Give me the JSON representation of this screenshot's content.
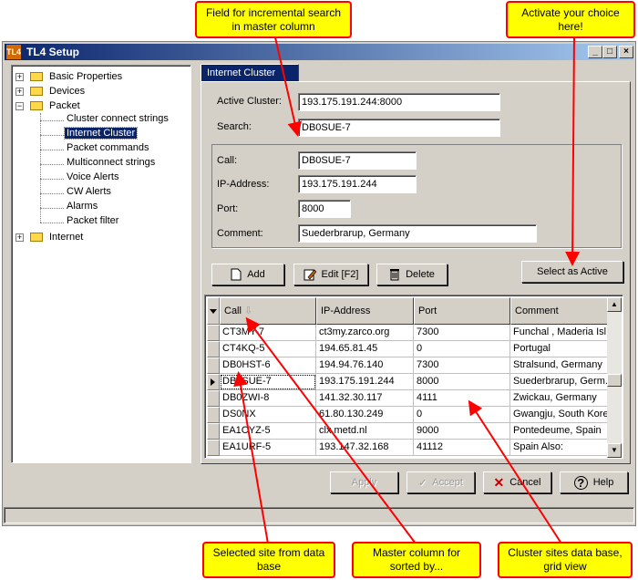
{
  "window": {
    "title": "TL4 Setup",
    "app_icon": "TL4"
  },
  "callouts": {
    "incremental_search": "Field for incremental search in master column",
    "activate": "Activate your choice here!",
    "selected_site": "Selected site from data base",
    "master_column": "Master column for sorted by...",
    "cluster_db": "Cluster sites data base, grid view"
  },
  "tree": {
    "items": [
      {
        "label": "Basic Properties"
      },
      {
        "label": "Devices"
      },
      {
        "label": "Packet"
      },
      {
        "label": "Cluster connect strings"
      },
      {
        "label": "Internet Cluster"
      },
      {
        "label": "Packet commands"
      },
      {
        "label": "Multiconnect strings"
      },
      {
        "label": "Voice Alerts"
      },
      {
        "label": "CW Alerts"
      },
      {
        "label": "Alarms"
      },
      {
        "label": "Packet filter"
      },
      {
        "label": "Internet"
      }
    ]
  },
  "tab": {
    "label": "Internet Cluster"
  },
  "form": {
    "active_cluster_label": "Active Cluster:",
    "active_cluster_value": "193.175.191.244:8000",
    "search_label": "Search:",
    "search_value": "DB0SUE-7",
    "call_label": "Call:",
    "call_value": "DB0SUE-7",
    "ip_label": "IP-Address:",
    "ip_value": "193.175.191.244",
    "port_label": "Port:",
    "port_value": "8000",
    "comment_label": "Comment:",
    "comment_value": "Suederbrarup, Germany"
  },
  "buttons": {
    "add": "Add",
    "edit": "Edit [F2]",
    "delete": "Delete",
    "select_active": "Select as Active",
    "apply": "Apply",
    "accept": "Accept",
    "cancel": "Cancel",
    "help": "Help"
  },
  "grid": {
    "columns": [
      "Call",
      "IP-Address",
      "Port",
      "Comment"
    ],
    "rows": [
      [
        "CT3MY-7",
        "ct3my.zarco.org",
        "7300",
        "Funchal , Maderia Isl..."
      ],
      [
        "CT4KQ-5",
        "194.65.81.45",
        "0",
        "Portugal"
      ],
      [
        "DB0HST-6",
        "194.94.76.140",
        "7300",
        "Stralsund, Germany"
      ],
      [
        "DB0SUE-7",
        "193.175.191.244",
        "8000",
        "Suederbrarup, Germ..."
      ],
      [
        "DB0ZWI-8",
        "141.32.30.117",
        "4111",
        "Zwickau, Germany"
      ],
      [
        "DS0NX",
        "61.80.130.249",
        "0",
        "Gwangju, South Korea"
      ],
      [
        "EA1CYZ-5",
        "clx.metd.nl",
        "9000",
        "Pontedeume, Spain"
      ],
      [
        "EA1URF-5",
        "193.147.32.168",
        "41112",
        "Spain  Also:"
      ]
    ],
    "selected_row": 3
  },
  "colors": {
    "callout_bg": "#ffff00",
    "callout_border": "#ff0000",
    "arrow": "#ff0000",
    "titlebar": "#0a246a",
    "face": "#d4d0c8"
  }
}
